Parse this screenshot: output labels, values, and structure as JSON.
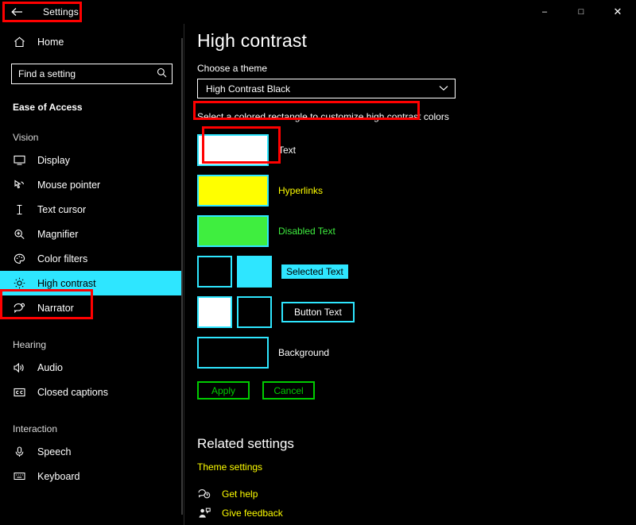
{
  "window": {
    "title": "Settings",
    "back_icon": "back-arrow-icon",
    "minimize_label": "–",
    "maximize_label": "□",
    "close_label": "✕"
  },
  "sidebar": {
    "home": {
      "label": "Home",
      "icon": "home-icon"
    },
    "search": {
      "placeholder": "Find a setting",
      "icon": "search-icon"
    },
    "section": "Ease of Access",
    "groups": [
      {
        "title": "Vision",
        "items": [
          {
            "label": "Display",
            "icon": "monitor-icon",
            "selected": false
          },
          {
            "label": "Mouse pointer",
            "icon": "mouse-pointer-icon",
            "selected": false
          },
          {
            "label": "Text cursor",
            "icon": "text-cursor-icon",
            "selected": false
          },
          {
            "label": "Magnifier",
            "icon": "magnifier-icon",
            "selected": false
          },
          {
            "label": "Color filters",
            "icon": "palette-icon",
            "selected": false
          },
          {
            "label": "High contrast",
            "icon": "sun-icon",
            "selected": true
          },
          {
            "label": "Narrator",
            "icon": "narrator-icon",
            "selected": false
          }
        ]
      },
      {
        "title": "Hearing",
        "items": [
          {
            "label": "Audio",
            "icon": "speaker-icon",
            "selected": false
          },
          {
            "label": "Closed captions",
            "icon": "closed-captions-icon",
            "selected": false
          }
        ]
      },
      {
        "title": "Interaction",
        "items": [
          {
            "label": "Speech",
            "icon": "microphone-icon",
            "selected": false
          },
          {
            "label": "Keyboard",
            "icon": "keyboard-icon",
            "selected": false
          }
        ]
      }
    ]
  },
  "main": {
    "page_title": "High contrast",
    "theme_label": "Choose a theme",
    "theme_value": "High Contrast Black",
    "chevron_icon": "chevron-down-icon",
    "hint": "Select a colored rectangle to customize high contrast colors",
    "swatches": [
      {
        "label": "Text",
        "style": "plain",
        "colors": [
          "#ffffff"
        ]
      },
      {
        "label": "Hyperlinks",
        "style": "link",
        "colors": [
          "#ffff00"
        ]
      },
      {
        "label": "Disabled Text",
        "style": "disabled",
        "colors": [
          "#3fee3f"
        ]
      },
      {
        "label": "Selected Text",
        "style": "selected-text",
        "colors": [
          "#000000",
          "#2ee6ff"
        ]
      },
      {
        "label": "Button Text",
        "style": "button-text",
        "colors": [
          "#ffffff",
          "#000000"
        ]
      },
      {
        "label": "Background",
        "style": "plain",
        "colors": [
          "#000000"
        ]
      }
    ],
    "apply_label": "Apply",
    "cancel_label": "Cancel",
    "related_title": "Related settings",
    "theme_settings_link": "Theme settings",
    "get_help": {
      "label": "Get help",
      "icon": "help-icon"
    },
    "give_feedback": {
      "label": "Give feedback",
      "icon": "feedback-icon"
    }
  },
  "colors": {
    "accent_cyan": "#2ee6ff",
    "annotation_red": "#ff0000",
    "button_green": "#00cc00",
    "link_yellow": "#ffff00"
  }
}
